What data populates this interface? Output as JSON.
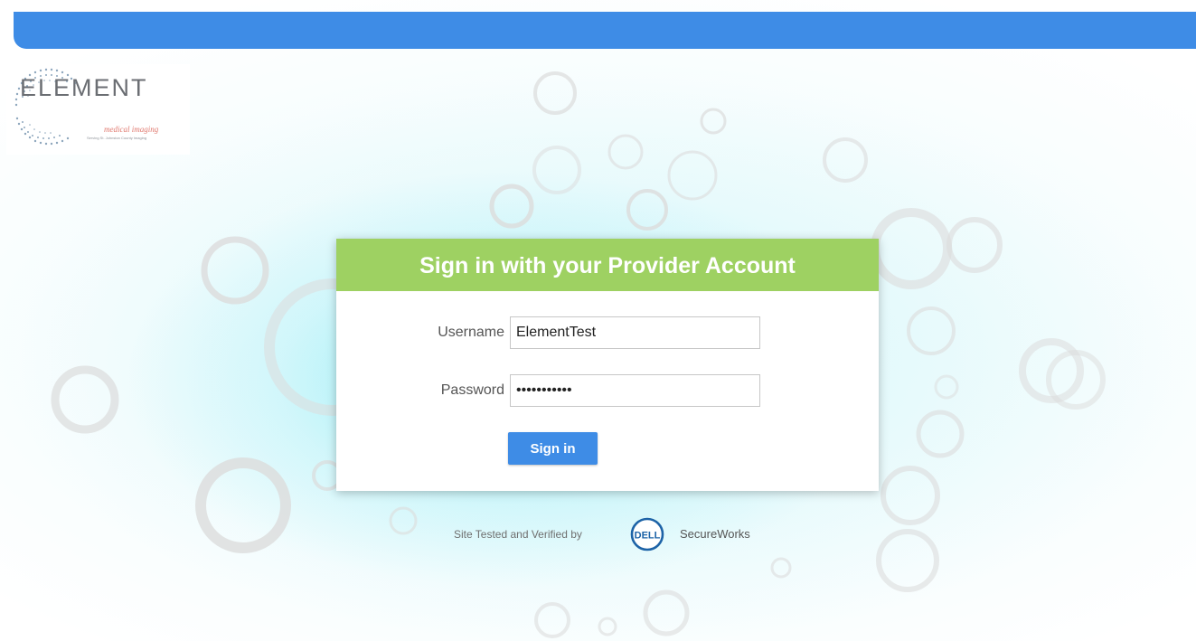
{
  "logo": {
    "wordmark": "ELEMENT",
    "subtitle": "medical imaging",
    "tagline": "Serving St. Johnston County Imaging"
  },
  "login": {
    "title": "Sign in with your Provider Account",
    "username_label": "Username",
    "username_value": "ElementTest",
    "password_label": "Password",
    "password_value": "elementtest",
    "submit_label": "Sign in"
  },
  "footer": {
    "verified_text": "Site Tested and Verified by",
    "dell_logo": "DELL",
    "secure_text": "SecureWorks"
  },
  "colors": {
    "topbar": "#3e8ce6",
    "header_green": "#9ed162",
    "button_blue": "#3e8ce6"
  }
}
